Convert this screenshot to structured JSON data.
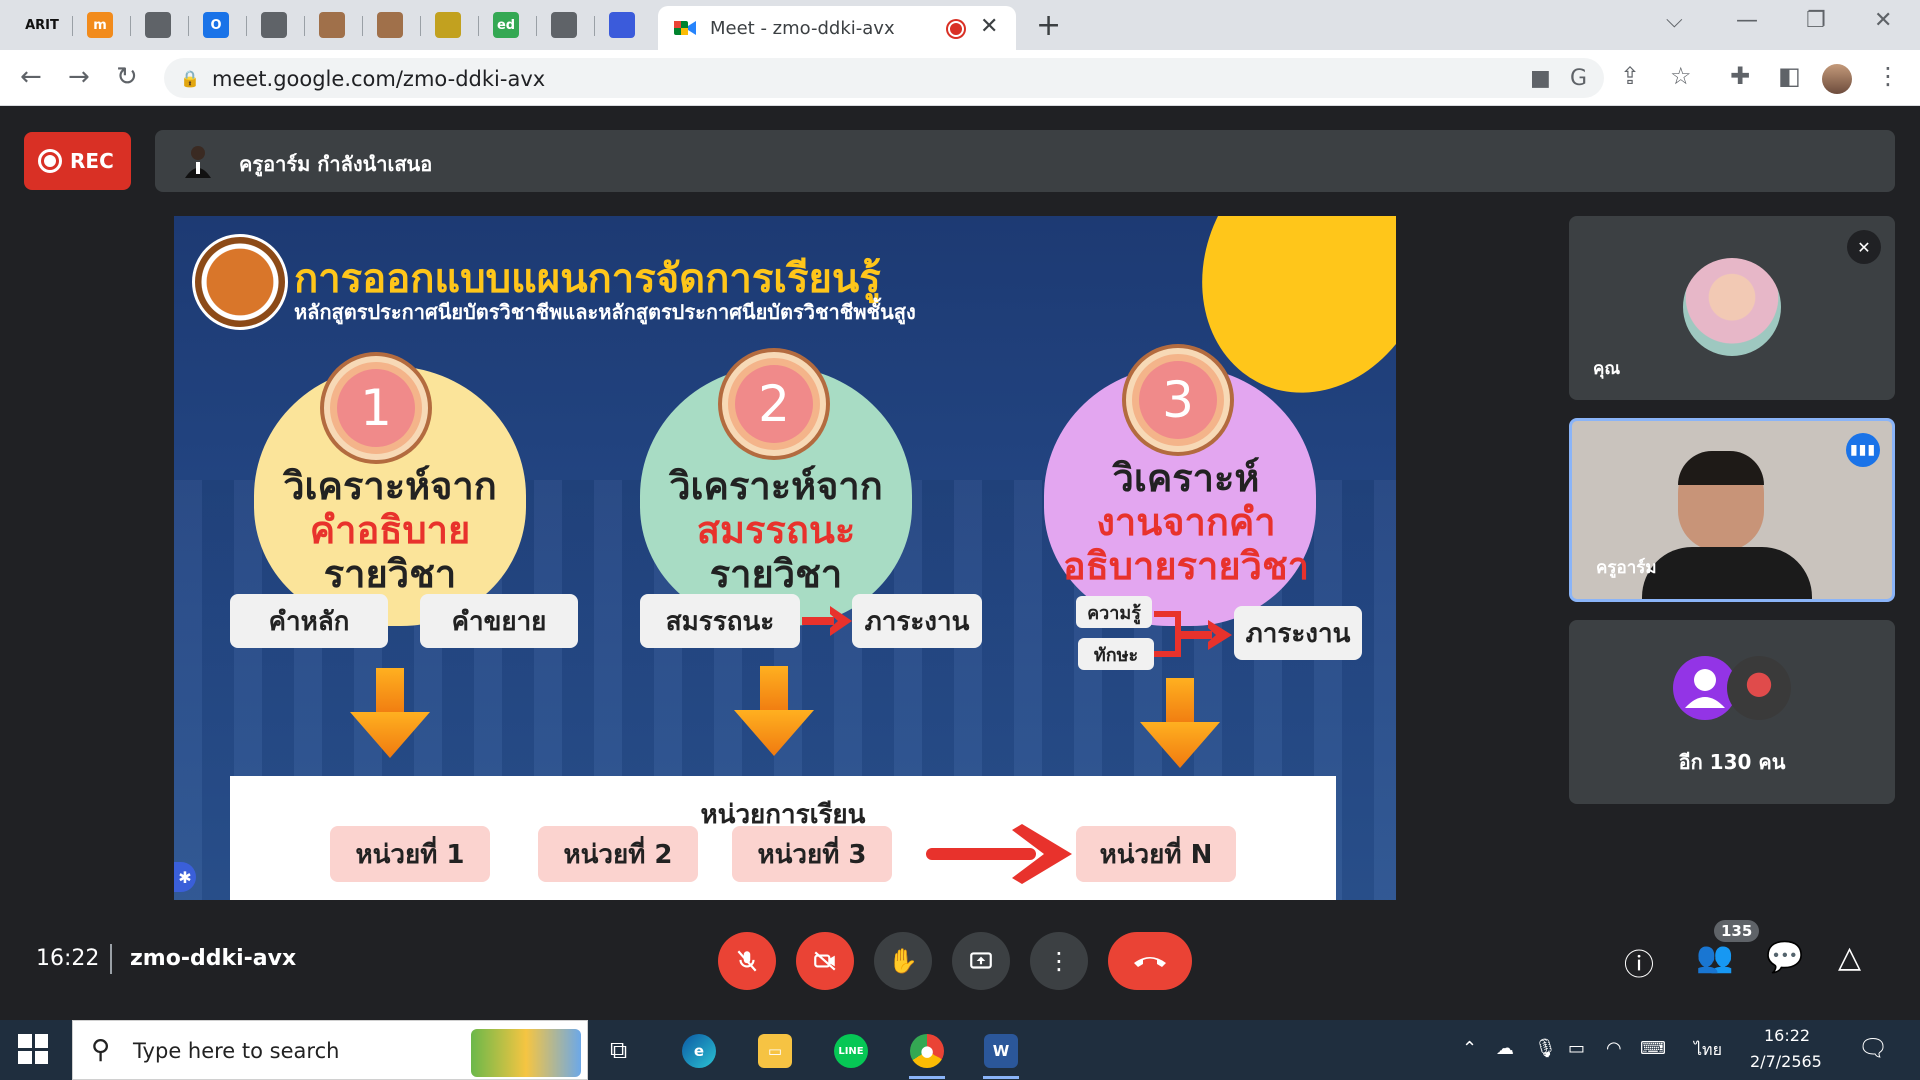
{
  "browser": {
    "active_tab_title": "Meet - zmo-ddki-avx",
    "url": "meet.google.com/zmo-ddki-avx",
    "pinned_tabs": [
      {
        "icon": "arit-icon",
        "label": "ARIT",
        "color": "#dee1e6"
      },
      {
        "icon": "m-logo-icon",
        "label": "m",
        "color": "#f28b1c"
      },
      {
        "icon": "globe-icon",
        "label": "",
        "color": "#5f6368"
      },
      {
        "icon": "opera-icon",
        "label": "O",
        "color": "#1a73e8"
      },
      {
        "icon": "globe-icon",
        "label": "",
        "color": "#5f6368"
      },
      {
        "icon": "person-icon",
        "label": "",
        "color": "#a0704a"
      },
      {
        "icon": "person-icon",
        "label": "",
        "color": "#a0704a"
      },
      {
        "icon": "seal-icon",
        "label": "",
        "color": "#c2a11f"
      },
      {
        "icon": "ed-icon",
        "label": "ed",
        "color": "#34a853"
      },
      {
        "icon": "globe-icon",
        "label": "",
        "color": "#5f6368"
      },
      {
        "icon": "forms-icon",
        "label": "",
        "color": "#3b5bdb"
      }
    ]
  },
  "meet": {
    "rec_label": "REC",
    "presenter_text": "ครูอาร์ม กำลังนำเสนอ",
    "time": "16:22",
    "meeting_code": "zmo-ddki-avx",
    "participant_count": "135",
    "tiles": [
      {
        "name": "คุณ"
      },
      {
        "name": "ครูอาร์ม"
      },
      {
        "name": "",
        "more_text": "อีก 130 คน"
      }
    ]
  },
  "slide": {
    "title": "การออกแบบแผนการจัดการเรียนรู้",
    "subtitle": "หลักสูตรประกาศนียบัตรวิชาชีพและหลักสูตรประกาศนียบัตรวิชาชีพชั้นสูง",
    "steps": [
      {
        "number": "1",
        "line1": "วิเคราะห์จาก",
        "line2": "คำอธิบาย",
        "line3": "รายวิชา",
        "pills": [
          "คำหลัก",
          "คำขยาย"
        ],
        "color": "#fbe49a"
      },
      {
        "number": "2",
        "line1": "วิเคราะห์จาก",
        "line2": "สมรรถนะ",
        "line3": "รายวิชา",
        "pills": [
          "สมรรถนะ",
          "ภาระงาน"
        ],
        "color": "#a8dcc4"
      },
      {
        "number": "3",
        "line1": "วิเคราะห์",
        "line2": "งานจากคำ",
        "line3": "อธิบายรายวิชา",
        "pills": [
          "ความรู้",
          "ทักษะ",
          "ภาระงาน"
        ],
        "color": "#e3a6f0"
      }
    ],
    "units_heading": "หน่วยการเรียน",
    "units": [
      "หน่วยที่ 1",
      "หน่วยที่ 2",
      "หน่วยที่ 3",
      "หน่วยที่ N"
    ]
  },
  "taskbar": {
    "search_placeholder": "Type here to search",
    "clock_time": "16:22",
    "clock_date": "2/7/2565",
    "language": "ไทย"
  },
  "colors": {
    "meet_bg": "#202124",
    "tile_bg": "#3c4043",
    "danger": "#ea4335",
    "accent": "#1a73e8",
    "slide_title": "#ffc61a"
  }
}
